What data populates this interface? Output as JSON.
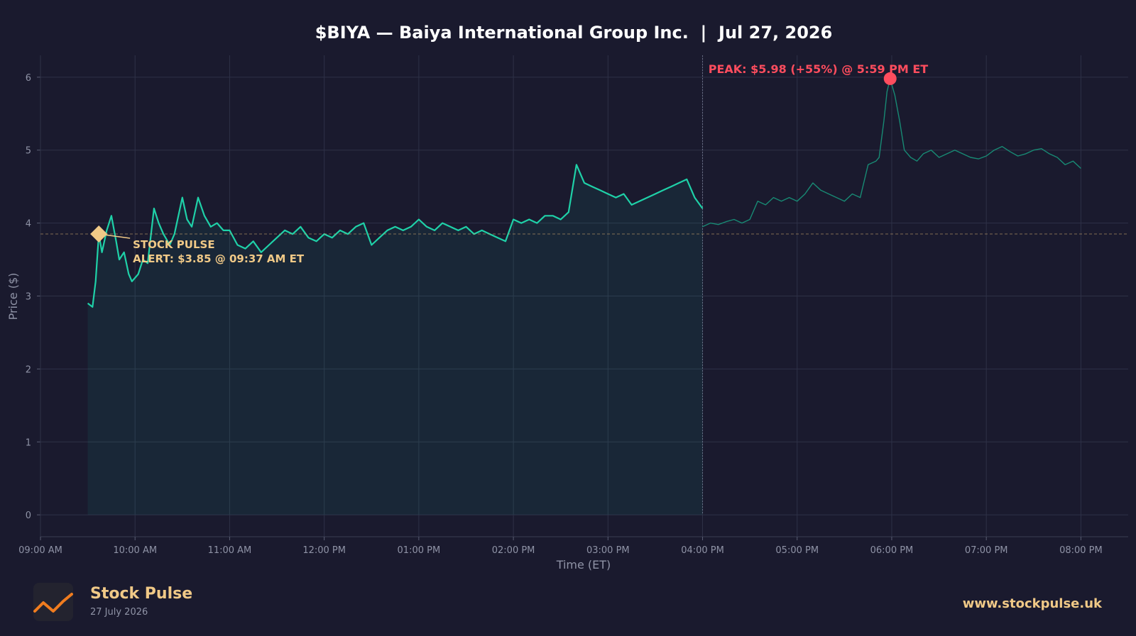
{
  "colors": {
    "background": "#1a1a2e",
    "regular_line": "#1fd1a8",
    "afterhours_line": "#188a74",
    "alert": "#f0c987",
    "peak": "#ff4d5e",
    "text": "#ffffff",
    "muted": "#8f93a6"
  },
  "chart_data": {
    "type": "line",
    "title": "$BIYA — Baiya International Group Inc.  |  Jul 27, 2026",
    "xlabel": "Time (ET)",
    "ylabel": "Price ($)",
    "ylim": [
      -0.3,
      6.3
    ],
    "yticks": [
      0,
      1,
      2,
      3,
      4,
      5,
      6
    ],
    "xlim": [
      "09:00",
      "20:30"
    ],
    "xticks": [
      "09:00 AM",
      "10:00 AM",
      "11:00 AM",
      "12:00 PM",
      "01:00 PM",
      "02:00 PM",
      "03:00 PM",
      "04:00 PM",
      "05:00 PM",
      "06:00 PM",
      "07:00 PM",
      "08:00 PM"
    ],
    "grid": true,
    "regular_session_end": "16:00",
    "series": [
      {
        "session": "regular",
        "style": "solid",
        "fill": true,
        "x": [
          "09:30",
          "09:33",
          "09:35",
          "09:37",
          "09:39",
          "09:42",
          "09:45",
          "09:48",
          "09:50",
          "09:53",
          "09:56",
          "09:58",
          "10:02",
          "10:05",
          "10:08",
          "10:12",
          "10:15",
          "10:18",
          "10:22",
          "10:25",
          "10:30",
          "10:33",
          "10:36",
          "10:40",
          "10:44",
          "10:48",
          "10:52",
          "10:56",
          "11:00",
          "11:05",
          "11:10",
          "11:15",
          "11:20",
          "11:25",
          "11:30",
          "11:35",
          "11:40",
          "11:45",
          "11:50",
          "11:55",
          "12:00",
          "12:05",
          "12:10",
          "12:15",
          "12:20",
          "12:25",
          "12:30",
          "12:35",
          "12:40",
          "12:45",
          "12:50",
          "12:55",
          "13:00",
          "13:05",
          "13:10",
          "13:15",
          "13:20",
          "13:25",
          "13:30",
          "13:35",
          "13:40",
          "13:45",
          "13:50",
          "13:55",
          "14:00",
          "14:05",
          "14:10",
          "14:15",
          "14:20",
          "14:25",
          "14:30",
          "14:35",
          "14:40",
          "14:45",
          "14:50",
          "14:55",
          "15:00",
          "15:05",
          "15:10",
          "15:15",
          "15:20",
          "15:25",
          "15:30",
          "15:35",
          "15:40",
          "15:45",
          "15:50",
          "15:55",
          "16:00"
        ],
        "y": [
          2.9,
          2.85,
          3.2,
          3.85,
          3.6,
          3.9,
          4.1,
          3.75,
          3.5,
          3.6,
          3.3,
          3.2,
          3.3,
          3.5,
          3.45,
          4.2,
          4.0,
          3.85,
          3.7,
          3.85,
          4.35,
          4.05,
          3.95,
          4.35,
          4.1,
          3.95,
          4.0,
          3.9,
          3.9,
          3.7,
          3.65,
          3.75,
          3.6,
          3.7,
          3.8,
          3.9,
          3.85,
          3.95,
          3.8,
          3.75,
          3.85,
          3.8,
          3.9,
          3.85,
          3.95,
          4.0,
          3.7,
          3.8,
          3.9,
          3.95,
          3.9,
          3.95,
          4.05,
          3.95,
          3.9,
          4.0,
          3.95,
          3.9,
          3.95,
          3.85,
          3.9,
          3.85,
          3.8,
          3.75,
          4.05,
          4.0,
          4.05,
          4.0,
          4.1,
          4.1,
          4.05,
          4.15,
          4.8,
          4.55,
          4.5,
          4.45,
          4.4,
          4.35,
          4.4,
          4.25,
          4.3,
          4.35,
          4.4,
          4.45,
          4.5,
          4.55,
          4.6,
          4.35,
          4.2
        ]
      },
      {
        "session": "after_hours",
        "style": "thin",
        "fill": false,
        "x": [
          "16:00",
          "16:05",
          "16:10",
          "16:15",
          "16:20",
          "16:25",
          "16:30",
          "16:35",
          "16:40",
          "16:45",
          "16:50",
          "16:55",
          "17:00",
          "17:05",
          "17:10",
          "17:15",
          "17:20",
          "17:25",
          "17:30",
          "17:35",
          "17:40",
          "17:45",
          "17:50",
          "17:52",
          "17:55",
          "17:57",
          "17:59",
          "18:02",
          "18:05",
          "18:08",
          "18:12",
          "18:16",
          "18:20",
          "18:25",
          "18:30",
          "18:35",
          "18:40",
          "18:45",
          "18:50",
          "18:55",
          "19:00",
          "19:05",
          "19:10",
          "19:15",
          "19:20",
          "19:25",
          "19:30",
          "19:35",
          "19:40",
          "19:45",
          "19:50",
          "19:55",
          "20:00"
        ],
        "y": [
          3.95,
          4.0,
          3.98,
          4.02,
          4.05,
          4.0,
          4.05,
          4.3,
          4.25,
          4.35,
          4.3,
          4.35,
          4.3,
          4.4,
          4.55,
          4.45,
          4.4,
          4.35,
          4.3,
          4.4,
          4.35,
          4.8,
          4.85,
          4.9,
          5.4,
          5.8,
          5.98,
          5.75,
          5.4,
          5.0,
          4.9,
          4.85,
          4.95,
          5.0,
          4.9,
          4.95,
          5.0,
          4.95,
          4.9,
          4.88,
          4.92,
          5.0,
          5.05,
          4.98,
          4.92,
          4.95,
          5.0,
          5.02,
          4.95,
          4.9,
          4.8,
          4.85,
          4.75
        ]
      }
    ],
    "reference_line": {
      "y": 3.85,
      "style": "dashed"
    },
    "annotations": [
      {
        "id": "alert",
        "x": "09:37",
        "y": 3.85,
        "marker": "diamond",
        "lines": [
          "STOCK PULSE",
          "ALERT: $3.85 @ 09:37 AM ET"
        ]
      },
      {
        "id": "peak",
        "x": "17:59",
        "y": 5.98,
        "marker": "circle",
        "lines": [
          "PEAK: $5.98 (+55%) @ 5:59 PM ET"
        ]
      }
    ]
  },
  "footer": {
    "brand_name": "Stock Pulse",
    "date": "27 July 2026",
    "website": "www.stockpulse.uk"
  }
}
